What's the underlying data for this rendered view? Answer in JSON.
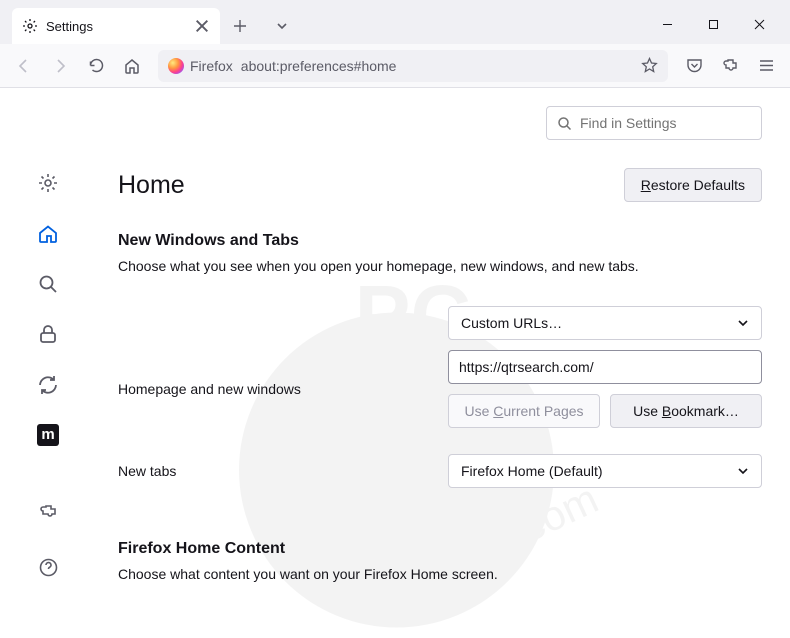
{
  "tab": {
    "title": "Settings"
  },
  "urlbar": {
    "identity": "Firefox",
    "address": "about:preferences#home"
  },
  "search": {
    "placeholder": "Find in Settings"
  },
  "header": {
    "title": "Home",
    "restore": "Restore Defaults"
  },
  "section1": {
    "title": "New Windows and Tabs",
    "caption": "Choose what you see when you open your homepage, new windows, and new tabs.",
    "homepageLabel": "Homepage and new windows",
    "homepageSelect": "Custom URLs…",
    "homepageUrl": "https://qtrsearch.com/",
    "useCurrent": "Use Current Pages",
    "useBookmark": "Use Bookmark…",
    "newTabsLabel": "New tabs",
    "newTabsSelect": "Firefox Home (Default)"
  },
  "section2": {
    "title": "Firefox Home Content",
    "caption": "Choose what content you want on your Firefox Home screen."
  },
  "sidebar": {
    "moz": "m"
  }
}
